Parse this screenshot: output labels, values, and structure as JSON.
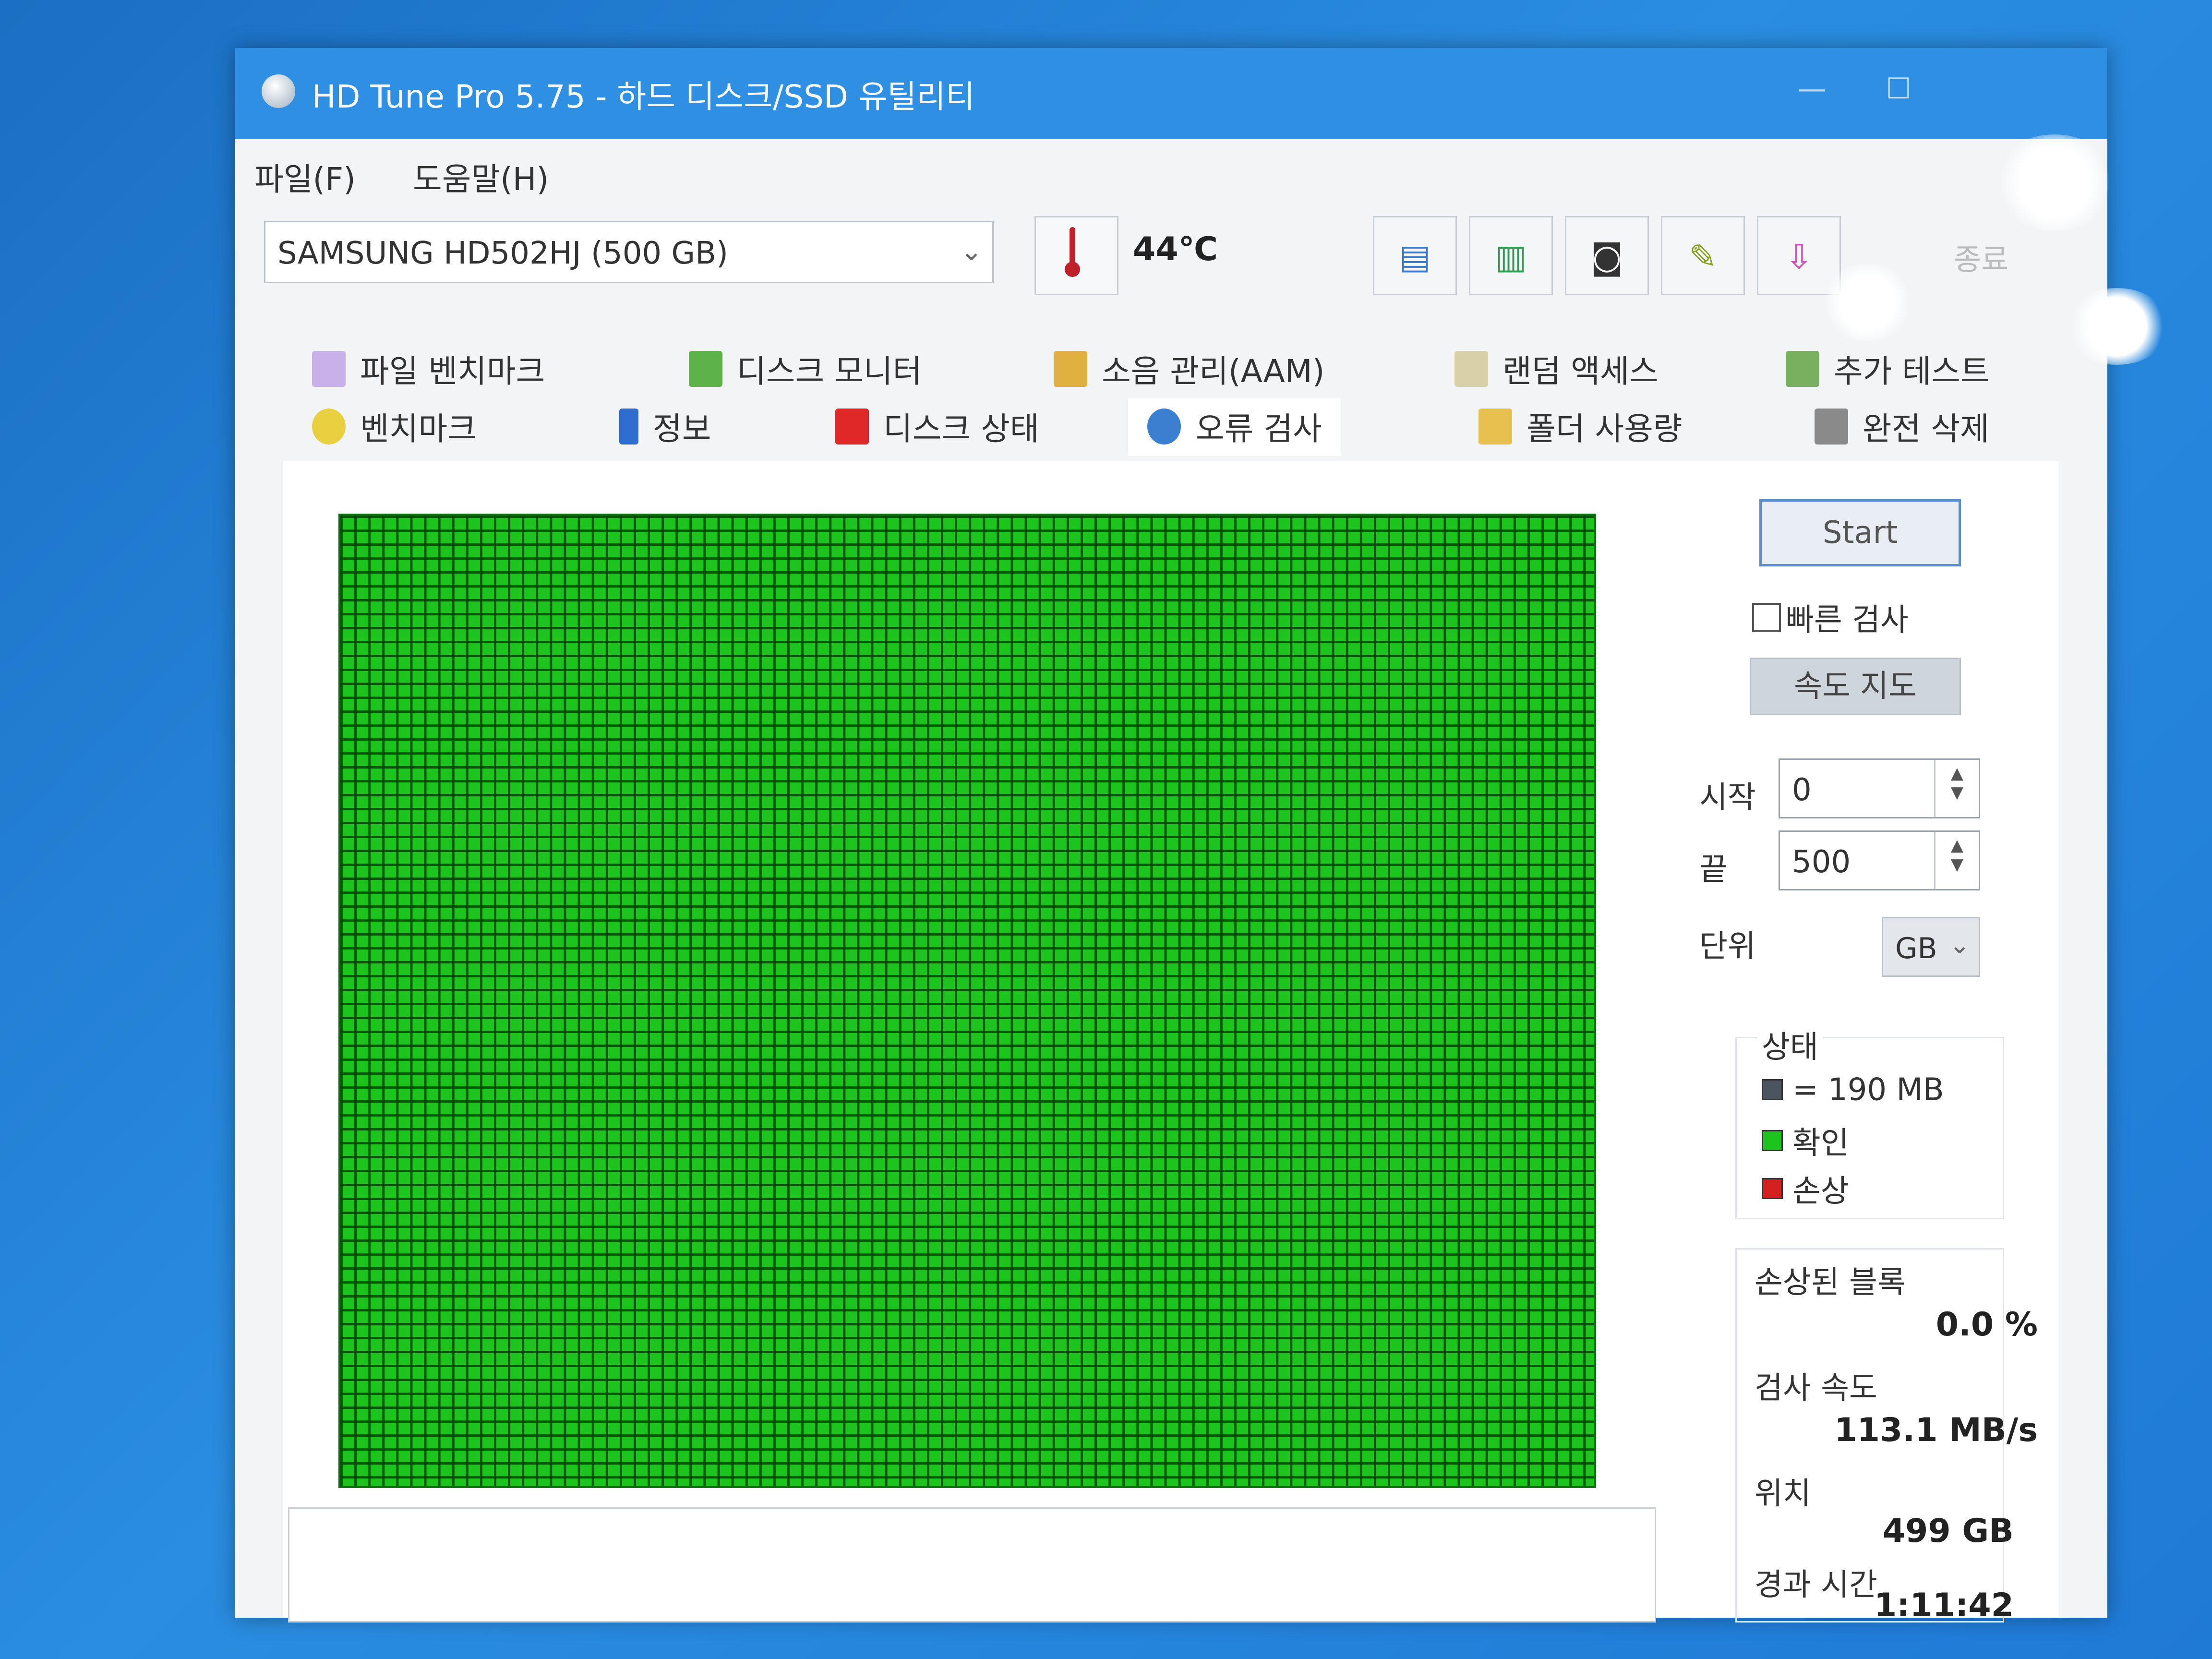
{
  "window": {
    "title": "HD Tune Pro 5.75 - 하드 디스크/SSD 유틸리티"
  },
  "menu": [
    "파일(F)",
    "도움말(H)"
  ],
  "toolbar": {
    "drive": "SAMSUNG HD502HJ (500 GB)",
    "temperature": "44℃",
    "exit_label": "종료"
  },
  "tabs": {
    "row1": [
      "파일 벤치마크",
      "디스크 모니터",
      "소음 관리(AAM)",
      "랜덤 액세스",
      "추가 테스트"
    ],
    "row2": [
      "벤치마크",
      "정보",
      "디스크 상태",
      "오류 검사",
      "폴더 사용량",
      "완전 삭제"
    ],
    "active": "오류 검사"
  },
  "error_scan": {
    "start_button": "Start",
    "quick_scan_label": "빠른 검사",
    "quick_scan_checked": false,
    "speed_map_button": "속도 지도",
    "start_label": "시작",
    "start_value": "0",
    "end_label": "끝",
    "end_value": "500",
    "unit_label": "단위",
    "unit_value": "GB",
    "status_title": "상태",
    "legend": [
      {
        "label": "= 190 MB",
        "color": "#4a5560"
      },
      {
        "label": "확인",
        "color": "#1ec41e"
      },
      {
        "label": "손상",
        "color": "#d42020"
      }
    ],
    "stats": {
      "damaged_blocks_label": "손상된 블록",
      "damaged_blocks_value": "0.0 %",
      "scan_speed_label": "검사 속도",
      "scan_speed_value": "113.1 MB/s",
      "position_label": "위치",
      "position_value": "499 GB",
      "elapsed_label": "경과 시간",
      "elapsed_value": "1:11:42"
    }
  },
  "colors": {
    "block_ok": "#1ec41e",
    "block_grid": "#004600",
    "title_bar": "#2f8fe2",
    "desktop": "#1f7ad6"
  }
}
